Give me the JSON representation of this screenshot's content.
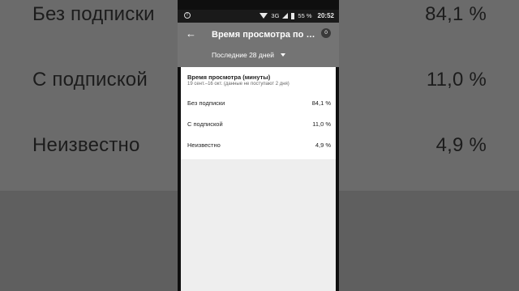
{
  "background": {
    "rows": [
      {
        "label": "Без подписки",
        "value": "84,1 %"
      },
      {
        "label": "С подпиской",
        "value": "11,0 %"
      },
      {
        "label": "Неизвестно",
        "value": "4,9 %"
      }
    ]
  },
  "status_bar": {
    "network": "3G",
    "battery": "55 %",
    "time": "20:52"
  },
  "app_bar": {
    "back_icon": "arrow-back-icon",
    "title": "Время просмотра по подписке",
    "notifications_count": "0",
    "date_range": "Последние 28 дней"
  },
  "card": {
    "title": "Время просмотра (минуты)",
    "subtitle": "19 сент.–16 окт. (данные не поступают 2 дня)",
    "rows": [
      {
        "label": "Без подписки",
        "value": "84,1 %"
      },
      {
        "label": "С подпиской",
        "value": "11,0 %"
      },
      {
        "label": "Неизвестно",
        "value": "4,9 %"
      }
    ]
  }
}
